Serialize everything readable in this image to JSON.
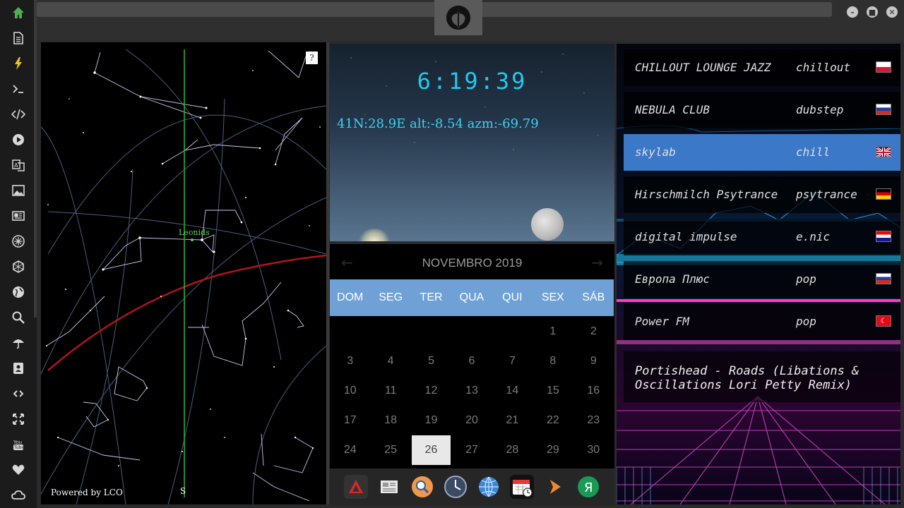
{
  "sidebar": {
    "items": [
      {
        "name": "home-icon",
        "active": true
      },
      {
        "name": "document-icon"
      },
      {
        "name": "lightning-icon"
      },
      {
        "name": "terminal-icon"
      },
      {
        "name": "code-icon"
      },
      {
        "name": "play-icon"
      },
      {
        "name": "translate-icon"
      },
      {
        "name": "image-icon"
      },
      {
        "name": "news-icon"
      },
      {
        "name": "rebel-icon"
      },
      {
        "name": "hexagon-icon"
      },
      {
        "name": "globe-icon"
      },
      {
        "name": "search-icon"
      },
      {
        "name": "umbrella-icon"
      },
      {
        "name": "contact-icon"
      },
      {
        "name": "link-icon"
      },
      {
        "name": "fullscreen-icon"
      },
      {
        "name": "youtube-icon"
      },
      {
        "name": "heart-icon"
      },
      {
        "name": "cloud-icon"
      }
    ],
    "active_color": "#4caf50"
  },
  "window": {
    "logo": "rebel-alliance-icon",
    "controls": [
      "minimize-icon",
      "maximize-icon",
      "close-icon"
    ]
  },
  "sky": {
    "help_label": "?",
    "powered_by": "Powered by LCO",
    "direction_label": "S",
    "meteor_shower": "Leonids"
  },
  "clock": {
    "time": "6:19:39",
    "coords": "41N:28.9E  alt:-8.54 azm:-69.79"
  },
  "calendar": {
    "title": "NOVEMBRO 2019",
    "prev_icon": "arrow-left-icon",
    "next_icon": "arrow-right-icon",
    "weekdays": [
      "DOM",
      "SEG",
      "TER",
      "QUA",
      "QUI",
      "SEX",
      "SÁB"
    ],
    "days": [
      "",
      "",
      "",
      "",
      "",
      "1",
      "2",
      "3",
      "4",
      "5",
      "6",
      "7",
      "8",
      "9",
      "10",
      "11",
      "12",
      "13",
      "14",
      "15",
      "16",
      "17",
      "18",
      "19",
      "20",
      "21",
      "22",
      "23",
      "24",
      "25",
      "26",
      "27",
      "28",
      "29",
      "30"
    ],
    "today": "26",
    "header_color": "#6fa1d6"
  },
  "dock": {
    "icons": [
      "app-red-icon",
      "newspaper-icon",
      "search-icon",
      "clock-icon",
      "globe-icon",
      "calendar-icon",
      "play-arrow-icon",
      "yandex-icon"
    ]
  },
  "radio": {
    "stations": [
      {
        "name": "CHILLOUT LOUNGE JAZZ",
        "genre": "chillout",
        "flag": "poland"
      },
      {
        "name": "NEBULA CLUB",
        "genre": "dubstep",
        "flag": "russia"
      },
      {
        "name": "skylab",
        "genre": "chill",
        "flag": "uk",
        "active": true
      },
      {
        "name": "Hirschmilch Psytrance",
        "genre": "psytrance",
        "flag": "germany"
      },
      {
        "name": "digital impulse",
        "genre": "e.nic",
        "flag": "croatia"
      },
      {
        "name": "Европа Плюс",
        "genre": "pop",
        "flag": "russia"
      },
      {
        "name": "Power FM",
        "genre": "pop",
        "flag": "turkey"
      }
    ],
    "now_playing": "Portishead - Roads (Libations & Oscillations Lori Petty Remix)",
    "active_color": "#3b78c8"
  }
}
